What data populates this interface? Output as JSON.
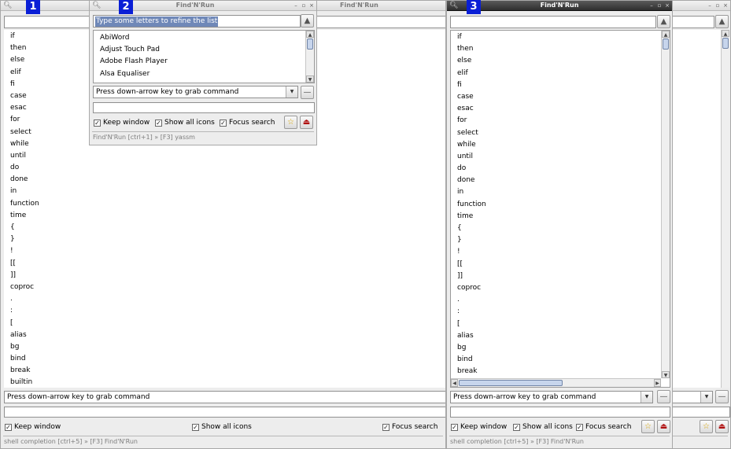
{
  "badges": {
    "one": "1",
    "two": "2",
    "three": "3"
  },
  "shell_keywords": [
    "if",
    "then",
    "else",
    "elif",
    "fi",
    "case",
    "esac",
    "for",
    "select",
    "while",
    "until",
    "do",
    "done",
    "in",
    "function",
    "time",
    "{",
    "}",
    "!",
    "[[",
    "]]",
    "coproc",
    ".",
    ":",
    "[",
    "alias",
    "bg",
    "bind",
    "break",
    "builtin"
  ],
  "window1": {
    "title": "Find'N'Run",
    "search": {
      "value": "",
      "placeholder": ""
    },
    "grab_hint": "Press down-arrow key to grab command",
    "secondary_input": "",
    "options": {
      "keep_window": "Keep window",
      "show_all_icons": "Show all icons",
      "focus_search": "Focus search"
    },
    "status": "shell completion [ctrl+5]  »  [F3] Find'N'Run"
  },
  "window2": {
    "title": "Find'N'Run",
    "search": {
      "value": "Type some letters to refine the list"
    },
    "apps": [
      "AbiWord",
      "Adjust Touch Pad",
      "Adobe Flash Player",
      "Alsa Equaliser"
    ],
    "grab_hint": "Press down-arrow key to grab command",
    "options": {
      "keep_window": "Keep window",
      "show_all_icons": "Show all icons",
      "focus_search": "Focus search"
    },
    "status": "Find'N'Run [ctrl+1]  »  [F3] yassm"
  },
  "window3": {
    "title": "Find'N'Run",
    "search": {
      "value": ""
    },
    "grab_hint": "Press down-arrow key to grab command",
    "options": {
      "keep_window": "Keep window",
      "show_all_icons": "Show all icons",
      "focus_search": "Focus search"
    },
    "status": "shell completion [ctrl+5]  »  [F3] Find'N'Run"
  },
  "right_window": {
    "title": "Find'N'Run"
  },
  "icons": {
    "search": "magnifier-icon",
    "minimize": "minimize-icon",
    "maximize": "maximize-icon",
    "close": "close-icon",
    "clear": "clear-search-icon",
    "favorite": "star-icon",
    "exit": "exit-icon",
    "remove": "minus-icon",
    "dropdown": "chevron-down-icon"
  }
}
